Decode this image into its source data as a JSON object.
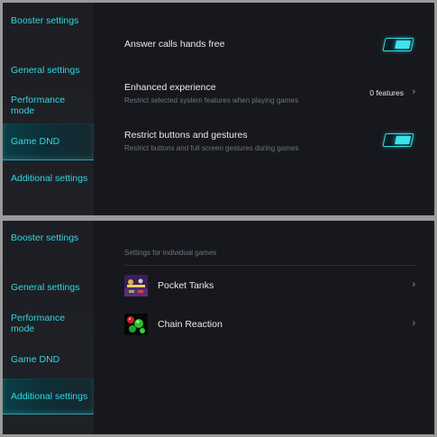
{
  "sidebar": {
    "items": [
      {
        "label": "Booster settings"
      },
      {
        "label": "General settings"
      },
      {
        "label": "Performance mode",
        "line1": "Performance",
        "line2": "mode"
      },
      {
        "label": "Game DND"
      },
      {
        "label": "Additional settings"
      }
    ]
  },
  "top": {
    "active_item": "Game DND",
    "rows": [
      {
        "title": "Answer calls hands free",
        "toggle": "on"
      },
      {
        "title": "Enhanced experience",
        "subtitle": "Restrict selected system features when playing games",
        "value": "0 features"
      },
      {
        "title": "Restrict buttons and gestures",
        "subtitle": "Restrict buttons and full screen gestures during games",
        "toggle": "on"
      }
    ]
  },
  "bottom": {
    "active_item": "Additional settings",
    "section_header": "Settings for individual games",
    "games": [
      {
        "name": "Pocket Tanks",
        "icon": "pocket-tanks-icon"
      },
      {
        "name": "Chain Reaction",
        "icon": "chain-reaction-icon"
      }
    ]
  },
  "colors": {
    "accent": "#35d6e0",
    "background": "#17181d",
    "sidebar": "#1e2025",
    "text": "#e8eaed",
    "muted": "#6f737b"
  }
}
